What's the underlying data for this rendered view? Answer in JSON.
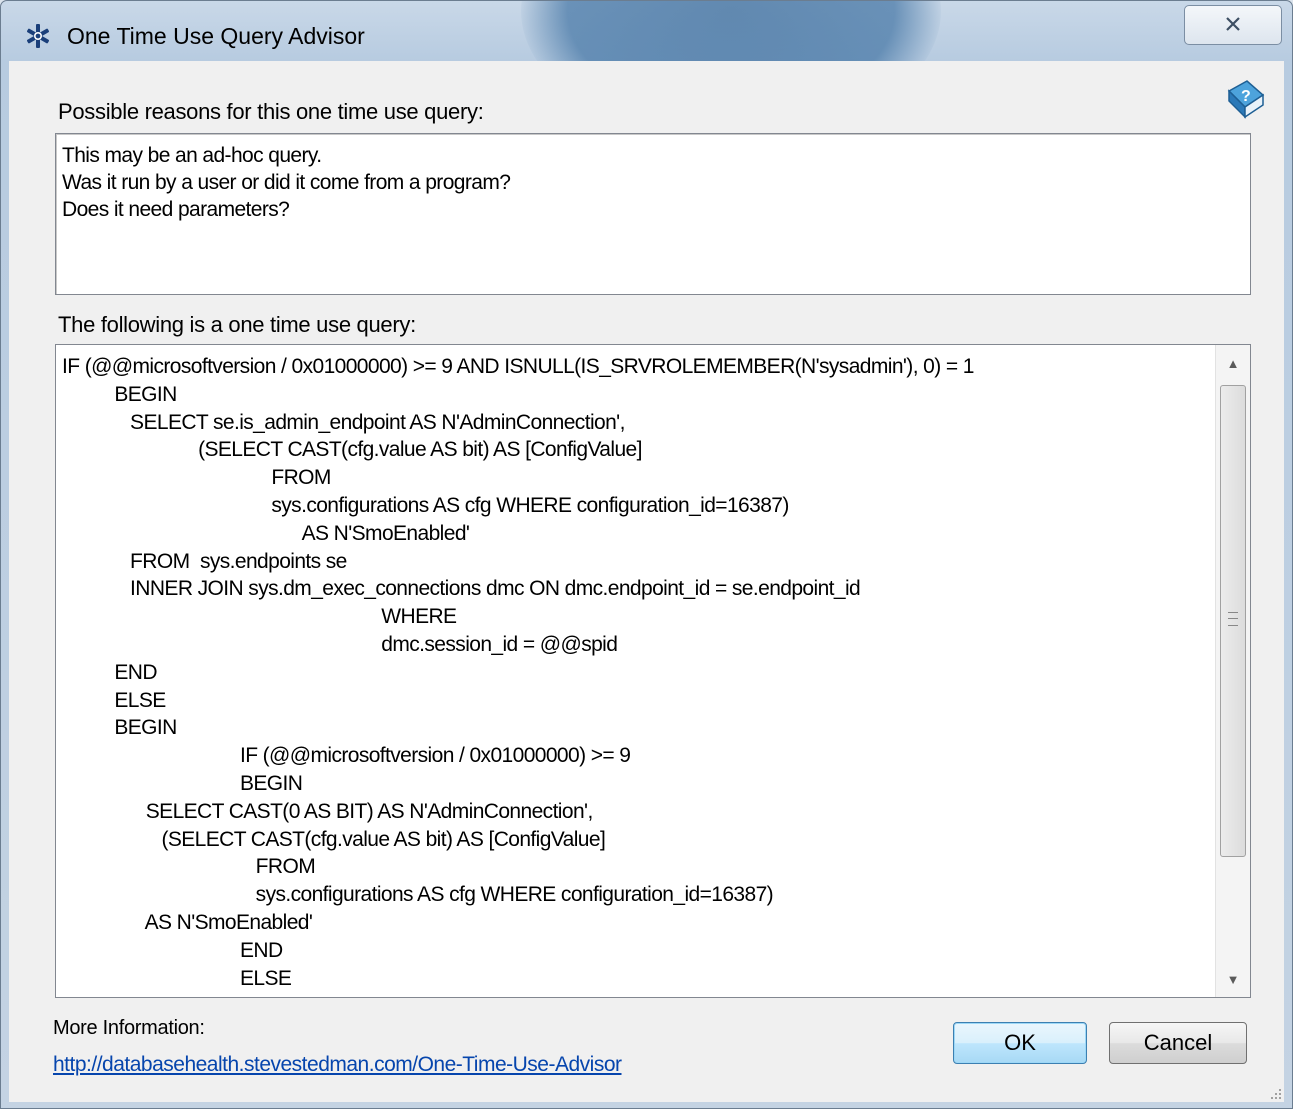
{
  "window": {
    "title": "One Time Use Query Advisor",
    "close_glyph": "☒",
    "app_icon": "asterisk-star-icon",
    "help_icon": "help-book-icon"
  },
  "reasons": {
    "label": "Possible reasons for this one time use query:",
    "lines": [
      "This may be an ad-hoc query.",
      "Was it run by a user or did it come from a program?",
      "Does it need parameters?"
    ]
  },
  "query": {
    "label": "The following is a one time use query:",
    "lines": [
      "IF (@@microsoftversion / 0x01000000) >= 9 AND ISNULL(IS_SRVROLEMEMBER(N'sysadmin'), 0) = 1",
      "          BEGIN",
      "             SELECT se.is_admin_endpoint AS N'AdminConnection',",
      "                          (SELECT CAST(cfg.value AS bit) AS [ConfigValue]",
      "                                        FROM",
      "                                        sys.configurations AS cfg WHERE configuration_id=16387)",
      "                                              AS N'SmoEnabled'",
      "             FROM  sys.endpoints se",
      "             INNER JOIN sys.dm_exec_connections dmc ON dmc.endpoint_id = se.endpoint_id",
      "                                                             WHERE",
      "                                                             dmc.session_id = @@spid",
      "          END",
      "          ELSE",
      "          BEGIN",
      "                                  IF (@@microsoftversion / 0x01000000) >= 9",
      "                                  BEGIN",
      "                SELECT CAST(0 AS BIT) AS N'AdminConnection',",
      "                   (SELECT CAST(cfg.value AS bit) AS [ConfigValue]",
      "                                     FROM",
      "                                     sys.configurations AS cfg WHERE configuration_id=16387)",
      "                AS N'SmoEnabled'",
      "                                  END",
      "                                  ELSE"
    ]
  },
  "footer": {
    "more_info_label": "More Information:",
    "link_text": "http://databasehealth.stevestedman.com/One-Time-Use-Advisor",
    "ok_label": "OK",
    "cancel_label": "Cancel"
  },
  "colors": {
    "link": "#0645ad",
    "titlebar": "#b7cbe0",
    "ok_button": "#bee6fd"
  }
}
